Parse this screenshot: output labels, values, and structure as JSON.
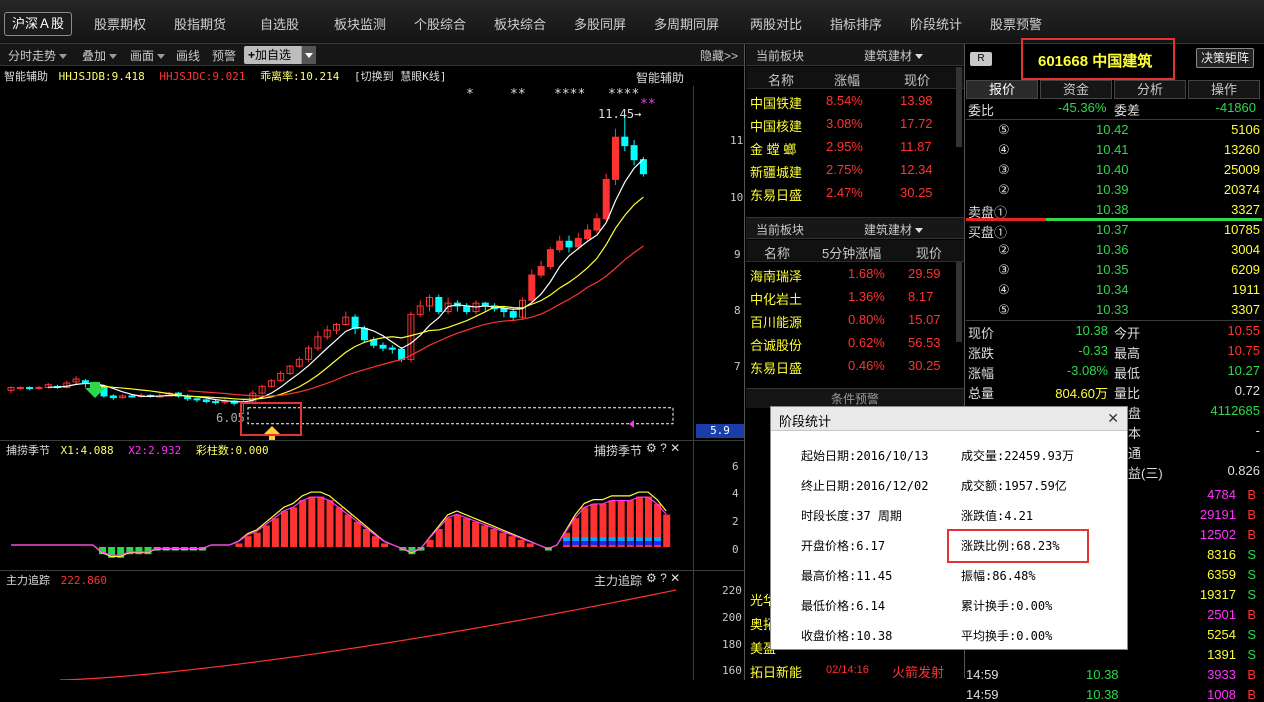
{
  "market_label": "沪深Ａ股",
  "menu": [
    "股票期权",
    "股指期货",
    "自选股",
    "板块监测",
    "个股综合",
    "板块综合",
    "多股同屏",
    "多周期同屏",
    "两股对比",
    "指标排序",
    "阶段统计",
    "股票预警"
  ],
  "toolbar": {
    "items": [
      "分时走势",
      "叠加",
      "画面",
      "画线",
      "预警"
    ],
    "add_label": "加自选",
    "hide_label": "隐藏>>"
  },
  "main_chart": {
    "title": "智能辅助",
    "title_right": "智能辅助",
    "hhjsjdb": "HHJSJDB:9.418",
    "hhjsjdc": "HHJSJDC:9.021",
    "guili": "乖离率:10.214",
    "switch": "[切换到 慧眼K线]",
    "high_label": "11.45→",
    "low_label": "6.05",
    "stars1": "*",
    "stars2": "**",
    "stars3": "****",
    "stars4": "****",
    "stars5": "**",
    "price_axis": [
      "11",
      "10",
      "9",
      "8",
      "7"
    ],
    "current_axis": "5.9"
  },
  "indicator1": {
    "title": "捕捞季节",
    "x1": "X1:4.088",
    "x2": "X2:2.932",
    "caizhu": "彩柱数:0.000",
    "right_title": "捕捞季节",
    "axis": [
      "6",
      "4",
      "2",
      "0"
    ]
  },
  "indicator2": {
    "title": "主力追踪",
    "value": "222.860",
    "right_title": "主力追踪",
    "axis": [
      "220",
      "200",
      "180",
      "160"
    ]
  },
  "sector1": {
    "header_label": "当前板块",
    "header_sector": "建筑建材",
    "cols": [
      "名称",
      "涨幅",
      "现价"
    ],
    "rows": [
      {
        "name": "中国铁建",
        "pct": "8.54%",
        "price": "13.98"
      },
      {
        "name": "中国核建",
        "pct": "3.08%",
        "price": "17.72"
      },
      {
        "name": "金 螳 螂",
        "pct": "2.95%",
        "price": "11.87"
      },
      {
        "name": "新疆城建",
        "pct": "2.75%",
        "price": "12.34"
      },
      {
        "name": "东易日盛",
        "pct": "2.47%",
        "price": "30.25"
      }
    ]
  },
  "sector2": {
    "header_label": "当前板块",
    "header_sector": "建筑建材",
    "cols": [
      "名称",
      "5分钟涨幅",
      "现价"
    ],
    "rows": [
      {
        "name": "海南瑞泽",
        "pct": "1.68%",
        "price": "29.59"
      },
      {
        "name": "中化岩土",
        "pct": "1.36%",
        "price": "8.17"
      },
      {
        "name": "百川能源",
        "pct": "0.80%",
        "price": "15.07"
      },
      {
        "name": "合诚股份",
        "pct": "0.62%",
        "price": "56.53"
      },
      {
        "name": "东易日盛",
        "pct": "0.46%",
        "price": "30.25"
      }
    ]
  },
  "condition_label": "条件预警",
  "alerts": [
    {
      "name": "光华",
      "time": "",
      "event": ""
    },
    {
      "name": "奥拓",
      "time": "",
      "event": ""
    },
    {
      "name": "美盈",
      "time": "",
      "event": ""
    },
    {
      "name": "拓日新能",
      "time": "02/14:16",
      "event": "火箭发射"
    }
  ],
  "stock": {
    "badge": "R",
    "code_name": "601668 中国建筑",
    "matrix_btn": "决策矩阵",
    "tabs": [
      "报价",
      "资金",
      "分析",
      "操作"
    ]
  },
  "order_book": {
    "weibi_label": "委比",
    "weibi": "-45.36%",
    "weicha_label": "委差",
    "weicha": "-41860",
    "sell": [
      {
        "label": "⑤",
        "price": "10.42",
        "vol": "5106"
      },
      {
        "label": "④",
        "price": "10.41",
        "vol": "13260"
      },
      {
        "label": "③",
        "price": "10.40",
        "vol": "25009"
      },
      {
        "label": "②",
        "price": "10.39",
        "vol": "20374"
      },
      {
        "label": "卖盘①",
        "price": "10.38",
        "vol": "3327"
      }
    ],
    "buy": [
      {
        "label": "买盘①",
        "price": "10.37",
        "vol": "10785"
      },
      {
        "label": "②",
        "price": "10.36",
        "vol": "3004"
      },
      {
        "label": "③",
        "price": "10.35",
        "vol": "6209"
      },
      {
        "label": "④",
        "price": "10.34",
        "vol": "1911"
      },
      {
        "label": "⑤",
        "price": "10.33",
        "vol": "3307"
      }
    ]
  },
  "quote_stats": [
    {
      "l1": "现价",
      "v1": "10.38",
      "l2": "今开",
      "v2": "10.55"
    },
    {
      "l1": "涨跌",
      "v1": "-0.33",
      "l2": "最高",
      "v2": "10.75"
    },
    {
      "l1": "涨幅",
      "v1": "-3.08%",
      "l2": "最低",
      "v2": "10.27"
    },
    {
      "l1": "总量",
      "v1": "804.60万",
      "l2": "量比",
      "v2": "0.72"
    }
  ],
  "partial_right": [
    {
      "label": "盘",
      "value": "4112685"
    },
    {
      "label": "本",
      "value": "-"
    },
    {
      "label": "通",
      "value": "-"
    },
    {
      "label": "益(三)",
      "value": "0.826"
    }
  ],
  "ticks": [
    {
      "time": "",
      "price": "",
      "vol": "4784",
      "side": "B"
    },
    {
      "time": "",
      "price": "",
      "vol": "29191",
      "side": "B"
    },
    {
      "time": "",
      "price": "",
      "vol": "12502",
      "side": "B"
    },
    {
      "time": "",
      "price": "",
      "vol": "8316",
      "side": "S"
    },
    {
      "time": "",
      "price": "",
      "vol": "6359",
      "side": "S"
    },
    {
      "time": "",
      "price": "",
      "vol": "19317",
      "side": "S"
    },
    {
      "time": "",
      "price": "",
      "vol": "2501",
      "side": "B"
    },
    {
      "time": "",
      "price": "",
      "vol": "5254",
      "side": "S"
    },
    {
      "time": "",
      "price": "",
      "vol": "1391",
      "side": "S"
    },
    {
      "time": "14:59",
      "price": "10.38",
      "vol": "3933",
      "side": "B"
    },
    {
      "time": "14:59",
      "price": "10.38",
      "vol": "1008",
      "side": "B"
    }
  ],
  "dialog": {
    "title": "阶段统计",
    "close": "✕",
    "left": [
      "起始日期:2016/10/13",
      "终止日期:2016/12/02",
      "时段长度:37 周期",
      "开盘价格:6.17",
      "最高价格:11.45",
      "最低价格:6.14",
      "收盘价格:10.38"
    ],
    "right": [
      "成交量:22459.93万",
      "成交额:1957.59亿",
      "涨跌值:4.21",
      "涨跌比例:68.23%",
      "振幅:86.48%",
      "累计换手:0.00%",
      "平均换手:0.00%"
    ]
  },
  "colors": {
    "up": "#ff3232",
    "down": "#00ffff",
    "green": "#2bd94a",
    "yellow": "#ffff33",
    "magenta": "#ff33ff",
    "highlight": "#e53333"
  }
}
